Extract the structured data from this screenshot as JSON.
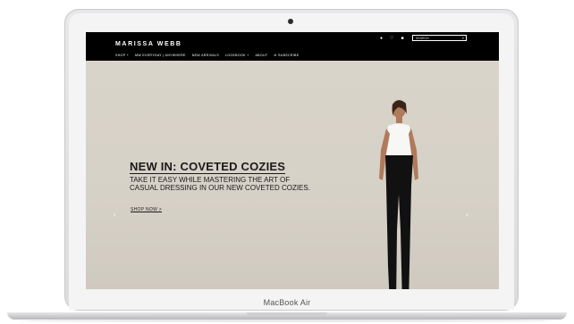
{
  "laptop": {
    "label": "MacBook Air"
  },
  "site": {
    "brand": "MARISSA WEBB",
    "nav": [
      "SHOP +",
      "MW EVERYDAY | ANYWHERE",
      "NEW ARRIVALS",
      "LOOKBOOK +",
      "ABOUT",
      "SUBSCRIBE"
    ],
    "search_placeholder": "SEARCH",
    "icons": [
      "user-icon",
      "wishlist-icon",
      "bag-icon",
      "search-icon"
    ]
  },
  "hero": {
    "headline": "NEW IN: COVETED COZIES",
    "subtext": "TAKE IT EASY WHILE MASTERING THE ART OF CASUAL DRESSING IN OUR NEW COVETED COZIES.",
    "cta": "SHOP NOW >",
    "prev": "‹",
    "next": "›"
  },
  "colors": {
    "header_bg": "#000000",
    "hero_bg": "#d9d4ca",
    "text": "#1a1a1a"
  }
}
